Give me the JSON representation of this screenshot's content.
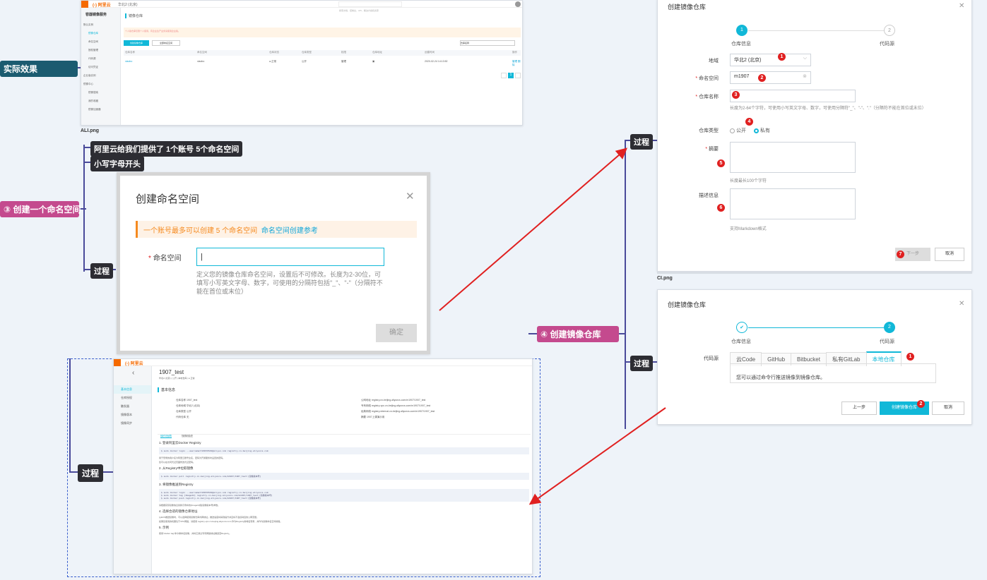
{
  "nodes": {
    "actual_effect": "实际效果",
    "aliyun_provides": "阿里云给我们提供了 1个账号 5个命名空间",
    "lowercase_start": "小写字母开头",
    "create_namespace": "③ 创建一个命名空间",
    "process": "过程",
    "create_repo": "④ 创建镜像仓库"
  },
  "captions": {
    "ali": "ALI.png",
    "ci": "CI.png"
  },
  "ali_shot": {
    "logo": "(-) 阿里云",
    "region": "华北2 (北京)",
    "search_placeholder": "搜索文档、控制台、API、解决方案和资源",
    "sidebar_title": "容器镜像服务",
    "sidebar_items": [
      "默认实例",
      "镜像仓库",
      "命名空间",
      "授权管理",
      "代码源",
      "访问凭证",
      "企业版实例",
      "镜像中心",
      "镜像搜索",
      "我的收藏",
      "镜像加速器"
    ],
    "page_title": "镜像仓库",
    "notice": "个人版仓库仅限个人使用，有企业生产业务请使用企业版。",
    "create_btn": "创建镜像仓库",
    "ns_select": "全部命名空间",
    "search_ph": "仓库名称",
    "headers": [
      "仓库名称",
      "命名空间",
      "仓库状态",
      "仓库类型",
      "权限",
      "仓库地址",
      "创建时间",
      "操作"
    ],
    "row": [
      "xiaobo",
      "xiaobo",
      "● 正常",
      "公开",
      "管理",
      "▣",
      "2020-02-24 14:13:52",
      "管理 删除"
    ],
    "page": "1"
  },
  "ns_dialog": {
    "title": "创建命名空间",
    "close": "✕",
    "notice_text": "一个账号最多可以创建 5 个命名空间",
    "notice_link": "命名空间创建参考",
    "label": "命名空间",
    "required": "*",
    "input_value": "|",
    "help": "定义您的镜像仓库命名空间，设置后不可修改。长度为2-30位，可填写小写英文字母、数字，可使用的分隔符包括\"_\"、\"-\"（分隔符不能在首位或末位）",
    "confirm": "确定"
  },
  "repo_dialog1": {
    "title": "创建镜像仓库",
    "close": "✕",
    "step1_num": "1",
    "step1_label": "仓库信息",
    "step2_num": "2",
    "step2_label": "代码源",
    "region_label": "地域",
    "region_value": "华北2 (北京)",
    "ns_label": "命名空间",
    "ns_value": "m1907",
    "name_label": "仓库名称",
    "name_help": "长度为2-64个字符，可使用小写英文字母、数字，可使用分隔符\"_\"、\"-\"、\".\"（分隔符不能在首位或末位）",
    "type_label": "仓库类型",
    "type_public": "公开",
    "type_private": "私有",
    "summary_label": "摘要",
    "summary_help": "长度最长100个字符",
    "desc_label": "描述信息",
    "desc_help": "支持Markdown格式",
    "next_btn": "下一步",
    "cancel_btn": "取消",
    "markers": [
      "1",
      "2",
      "3",
      "4",
      "5",
      "6",
      "7"
    ]
  },
  "repo_dialog2": {
    "title": "创建镜像仓库",
    "close": "✕",
    "step1_check": "✔",
    "step1_label": "仓库信息",
    "step2_num": "2",
    "step2_label": "代码源",
    "code_source_label": "代码源",
    "tabs": [
      "云Code",
      "GitHub",
      "Bitbucket",
      "私有GitLab",
      "本地仓库"
    ],
    "tab_note": "您可以通过命令行推送镜像到镜像仓库。",
    "prev_btn": "上一步",
    "create_btn": "创建镜像仓库",
    "cancel_btn": "取消",
    "markers": [
      "1",
      "2"
    ]
  },
  "detail_shot": {
    "logo": "(-) 阿里云",
    "back": "‹",
    "repo_name": "1907_test",
    "repo_meta": "华北2 (北京) | 公开 | 本地仓库 | ● 正常",
    "side_items": [
      "基本信息",
      "仓库授权",
      "触发器",
      "镜像版本",
      "镜像同步"
    ],
    "section": "基本信息",
    "info_left": [
      "仓库名称  1907_test",
      "仓库地域  华北2 (北京)",
      "仓库类型  公开",
      "代码仓库  无"
    ],
    "info_right": [
      "公网地址  registry.cn-beijing.aliyuncs.com/m1907/1907_test",
      "专有网络  registry-vpc.cn-beijing.aliyuncs.com/m1907/1907_test",
      "经典网络  registry-internal.cn-beijing.aliyuncs.com/m1907/1907_test",
      "摘要  1907上课演示用"
    ],
    "tabs": [
      "操作指南",
      "镜像描述"
    ],
    "steps": [
      "1. 登录阿里云Docker Registry",
      "2. 从Registry中拉取镜像",
      "3. 将镜像推送到Registry",
      "4. 选择合适的镜像仓库地址",
      "5. 示例"
    ],
    "code1": "$ sudo docker login --username=tb5839529@aliyun.com registry.cn-beijing.aliyuncs.com",
    "code2": "$ sudo docker pull registry.cn-beijing.aliyuncs.com/m1907/1907_test:[镜像版本号]",
    "code3": "$ sudo docker login --username=tb5839529@aliyun.com registry.cn-beijing.aliyuncs.com\n$ sudo docker tag [ImageId] registry.cn-beijing.aliyuncs.com/m1907/1907_test:[镜像版本号]\n$ sudo docker push registry.cn-beijing.aliyuncs.com/m1907/1907_test:[镜像版本号]",
    "text1": "用于登录的用户名为阿里云账号全名，密码为开通服务时设置的密码。",
    "text2": "您可以在访问凭证页面修改凭证密码。",
    "text3": "请根据实际镜像信息替换示例中的[ImageId]和[镜像版本号]参数。",
    "text4": "从ECS推送镜像时，可以选择使用镜像仓库内网地址。推送速度将得到提升并且将不会损耗您的公网流量。",
    "text5": "如果您使用的机器位于VPC网络，请使用 registry-vpc.cn-beijing.aliyuncs.com 作为Registry的域名登录，并作为镜像命名空间前缀。",
    "text6": "使用\"docker tag\"命令重命名镜像，并将它通过专有网络地址推送至Registry。"
  },
  "colors": {
    "accent": "#11b8d8",
    "arrow": "#e02020",
    "node_dark": "#2e3847",
    "node_teal": "#1b5b70",
    "node_pink": "#c44a8e",
    "connector": "#4a4a9a"
  }
}
